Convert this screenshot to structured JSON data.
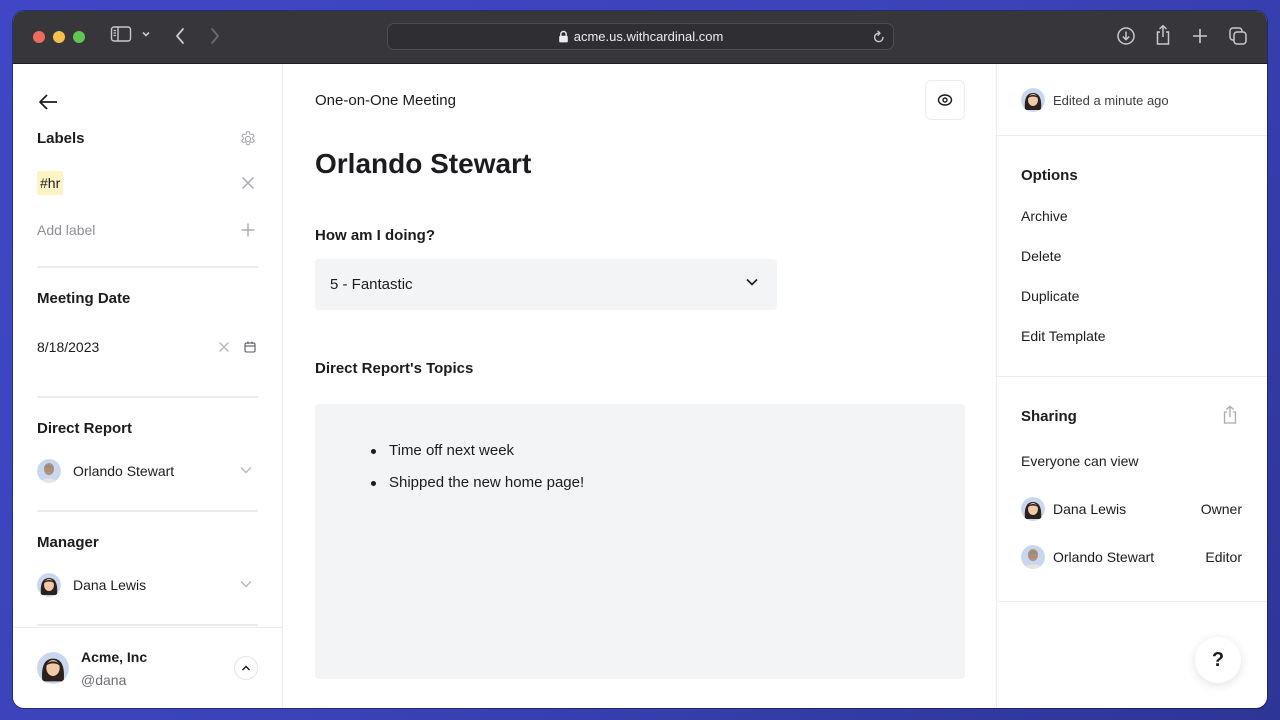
{
  "browser": {
    "url": "acme.us.withcardinal.com",
    "icons": [
      "sidebar-icon",
      "chevron-down-icon",
      "back-icon",
      "forward-icon",
      "lock-icon",
      "reload-icon",
      "download-icon",
      "share-icon",
      "new-tab-icon",
      "tabs-icon"
    ]
  },
  "left_panel": {
    "labels": {
      "title": "Labels",
      "tags": [
        {
          "text": "#hr",
          "color": "#fdf3c4"
        }
      ],
      "add_label": "Add label"
    },
    "meeting_date": {
      "title": "Meeting Date",
      "value": "8/18/2023"
    },
    "direct_report": {
      "title": "Direct Report",
      "value": "Orlando Stewart"
    },
    "manager": {
      "title": "Manager",
      "value": "Dana Lewis"
    },
    "user": {
      "org": "Acme, Inc",
      "handle": "@dana"
    }
  },
  "main": {
    "breadcrumb": "One-on-One Meeting",
    "title": "Orlando Stewart",
    "question": {
      "label": "How am I doing?",
      "selected": "5 - Fantastic"
    },
    "topics": {
      "label": "Direct Report's Topics",
      "items": [
        "Time off next week",
        "Shipped the new home page!"
      ]
    }
  },
  "right_panel": {
    "edited": "Edited a minute ago",
    "options": {
      "title": "Options",
      "items": [
        "Archive",
        "Delete",
        "Duplicate",
        "Edit Template"
      ]
    },
    "sharing": {
      "title": "Sharing",
      "visibility": "Everyone can view",
      "members": [
        {
          "name": "Dana Lewis",
          "role": "Owner"
        },
        {
          "name": "Orlando Stewart",
          "role": "Editor"
        }
      ]
    },
    "help": "?"
  }
}
